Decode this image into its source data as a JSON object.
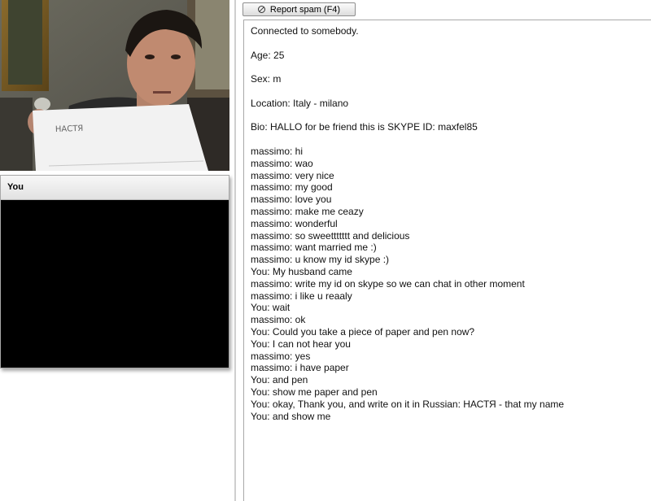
{
  "stranger_video": {
    "paper_text": "НАСТЯ"
  },
  "own_video": {
    "title": "You"
  },
  "toolbar": {
    "report_spam_label": "Report spam (F4)",
    "report_icon": "ban-icon"
  },
  "chat": {
    "status": "Connected to somebody.",
    "age": "Age: 25",
    "sex": "Sex: m",
    "location": "Location: Italy - milano",
    "bio": "Bio: HALLO for be friend this is SKYPE ID: maxfel85",
    "messages": [
      "massimo: hi",
      "massimo: wao",
      "massimo: very nice",
      "massimo: my good",
      "massimo: love you",
      "massimo: make me ceazy",
      "massimo: wonderful",
      "massimo: so sweettttttt and delicious",
      "massimo: want married me :)",
      "massimo: u know my id skype :)",
      "You: My husband came",
      "massimo: write my id on skype so we can chat in other moment",
      "massimo: i like u reaaly",
      "You: wait",
      "massimo: ok",
      "You: Could you take a piece of paper and pen now?",
      "You: I can not hear you",
      "massimo: yes",
      "massimo: i have paper",
      "You: and pen",
      "You: show me paper and pen",
      "You: okay, Thank you, and write on it in Russian: НАСТЯ - that my name",
      "You: and show me"
    ]
  }
}
